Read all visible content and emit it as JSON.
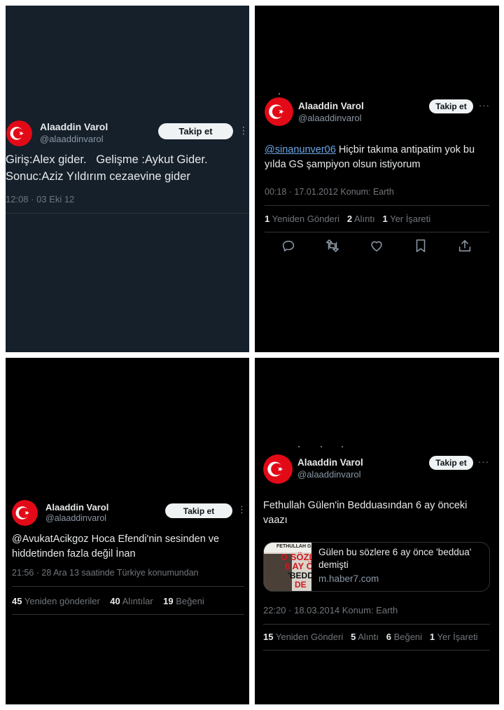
{
  "tweet1": {
    "name": "Alaaddin Varol",
    "handle": "@alaaddinvarol",
    "follow_label": "Takip et",
    "more_label": "⋮",
    "line1": "Giriş:Alex gider.   Gelişme :Aykut Gider.",
    "line2": "Sonuc:Aziz Yıldırım cezaevine gider",
    "meta": "12:08 · 03 Eki 12"
  },
  "tweet2": {
    "name": "Alaaddin Varol",
    "handle": "@alaaddinvarol",
    "follow_label": "Takip et",
    "more_label": "···",
    "mention": "@sinanunver06",
    "text_rest": " Hiçbir takıma antipatim yok bu yılda GS şampiyon olsun istiyorum",
    "meta": "00:18 · 17.01.2012 Konum: Earth",
    "stats": [
      {
        "value": "1",
        "label": "Yeniden Gönderi"
      },
      {
        "value": "2",
        "label": "Alıntı"
      },
      {
        "value": "1",
        "label": "Yer İşareti"
      }
    ],
    "actions": [
      "reply-icon",
      "retweet-icon",
      "like-icon",
      "bookmark-icon",
      "share-icon"
    ]
  },
  "tweet3": {
    "name": "Alaaddin Varol",
    "handle": "@alaaddinvarol",
    "follow_label": "Takip et",
    "more_label": "⋮",
    "mention": "@AvukatAcikgoz",
    "text_rest": " Hoca Efendi'nin sesinden ve hiddetinden fazla değil İnan",
    "meta": "21:56 · 28 Ara 13 saatinde Türkiye konumundan",
    "stats": [
      {
        "value": "45",
        "label": "Yeniden gönderiler"
      },
      {
        "value": "40",
        "label": "Alıntılar"
      },
      {
        "value": "19",
        "label": "Beğeni"
      }
    ]
  },
  "tweet4": {
    "name": "Alaaddin Varol",
    "handle": "@alaaddinvarol",
    "follow_label": "Takip et",
    "more_label": "···",
    "text": "Fethullah Gülen'in Bedduasından 6 ay önceki vaazı",
    "card": {
      "title": "Gülen bu sözlere 6 ay önce 'beddua' demişti",
      "domain": "m.haber7.com",
      "thumb_top": "FETHULLAH G",
      "thumb_line1": "O SÖZL",
      "thumb_line2": "6 AY Ö",
      "thumb_line3": "'BEDD",
      "thumb_line4": "DE"
    },
    "meta": "22:20 · 18.03.2014 Konum: Earth",
    "stats": [
      {
        "value": "15",
        "label": "Yeniden Gönderi"
      },
      {
        "value": "5",
        "label": "Alıntı"
      },
      {
        "value": "6",
        "label": "Beğeni"
      },
      {
        "value": "1",
        "label": "Yer İşareti"
      }
    ]
  },
  "colors": {
    "dim_bg": "#15202b",
    "black_bg": "#000000",
    "flag_red": "#e30a17",
    "link_blue": "#1d9bf0"
  }
}
